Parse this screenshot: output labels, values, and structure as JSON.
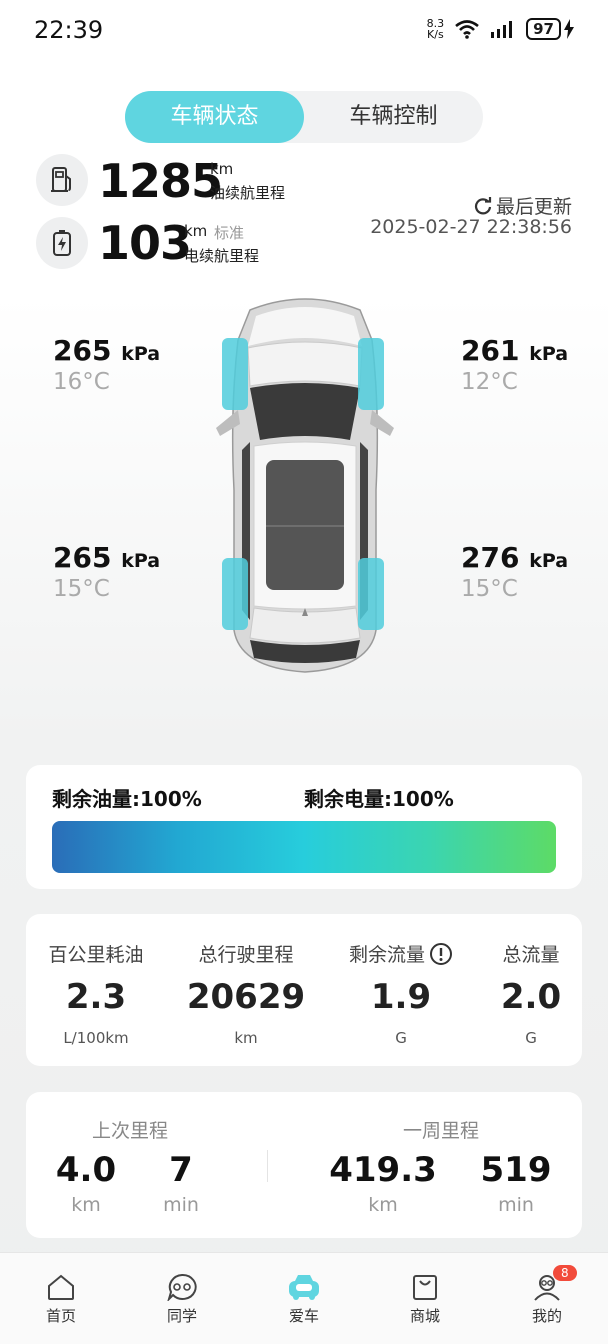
{
  "status_bar": {
    "time": "22:39",
    "net_speed": "8.3",
    "net_unit": "K/s",
    "battery": "97"
  },
  "tabs": [
    {
      "label": "车辆状态",
      "active": true
    },
    {
      "label": "车辆控制",
      "active": false
    }
  ],
  "fuel_range": {
    "value": "1285",
    "unit": "km",
    "label": "油续航里程",
    "icon": "fuel-pump-icon"
  },
  "electric_range": {
    "value": "103",
    "unit": "km",
    "tag": "标准",
    "label": "电续航里程",
    "icon": "battery-charge-icon"
  },
  "update": {
    "label": "最后更新",
    "timestamp": "2025-02-27 22:38:56"
  },
  "tires": {
    "front_left": {
      "pressure": "265",
      "unit": "kPa",
      "temp": "16°C"
    },
    "front_right": {
      "pressure": "261",
      "unit": "kPa",
      "temp": "12°C"
    },
    "rear_left": {
      "pressure": "265",
      "unit": "kPa",
      "temp": "15°C"
    },
    "rear_right": {
      "pressure": "276",
      "unit": "kPa",
      "temp": "15°C"
    }
  },
  "levels": {
    "fuel_label": "剩余油量:100%",
    "fuel_fraction": 1.0,
    "electric_label": "剩余电量:100%",
    "electric_fraction": 1.0
  },
  "stats": [
    {
      "title": "百公里耗油",
      "value": "2.3",
      "unit": "L/100km"
    },
    {
      "title": "总行驶里程",
      "value": "20629",
      "unit": "km"
    },
    {
      "title": "剩余流量",
      "value": "1.9",
      "unit": "G"
    },
    {
      "title": "总流量",
      "value": "2.0",
      "unit": "G"
    }
  ],
  "trips": {
    "last": {
      "title": "上次里程",
      "distance": "4.0",
      "distance_unit": "km",
      "duration": "7",
      "duration_unit": "min"
    },
    "week": {
      "title": "一周里程",
      "distance": "419.3",
      "distance_unit": "km",
      "duration": "519",
      "duration_unit": "min"
    }
  },
  "nav": [
    {
      "label": "首页",
      "icon": "home-icon"
    },
    {
      "label": "同学",
      "icon": "chat-icon"
    },
    {
      "label": "爱车",
      "icon": "car-icon",
      "active": true
    },
    {
      "label": "商城",
      "icon": "shopping-bag-icon"
    },
    {
      "label": "我的",
      "icon": "profile-icon",
      "badge": "8"
    }
  ],
  "colors": {
    "accent": "#5fd5e0",
    "badge": "#f24b3b",
    "tire_highlight": "#5fd5e0"
  }
}
